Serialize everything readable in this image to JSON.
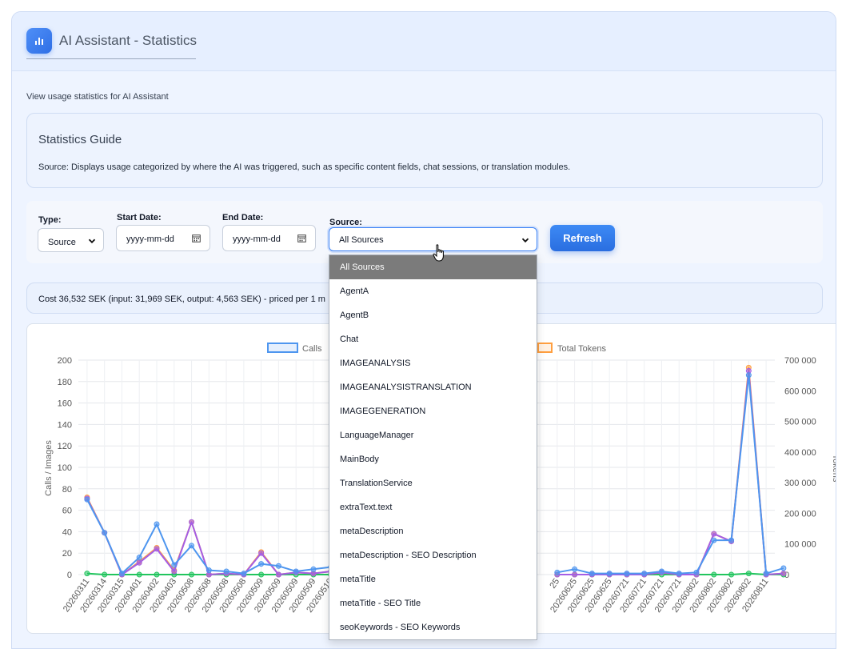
{
  "header": {
    "title": "AI Assistant - Statistics",
    "icon": "bar-chart-icon"
  },
  "subtitle": "View usage statistics for AI Assistant",
  "guide": {
    "title": "Statistics Guide",
    "text": "Source: Displays usage categorized by where the AI was triggered, such as specific content fields, chat sessions, or translation modules."
  },
  "filters": {
    "type_label": "Type:",
    "type_value": "Source",
    "start_label": "Start Date:",
    "start_placeholder": "yyyy-mm-dd",
    "end_label": "End Date:",
    "end_placeholder": "yyyy-mm-dd",
    "source_label": "Source:",
    "source_value": "All Sources",
    "refresh_label": "Refresh"
  },
  "cost_text": "Cost 36,532 SEK (input: 31,969 SEK, output: 4,563 SEK) - priced per 1 m",
  "dropdown": {
    "options": [
      "All Sources",
      "AgentA",
      "AgentB",
      "Chat",
      "IMAGEANALYSIS",
      "IMAGEANALYSISTRANSLATION",
      "IMAGEGENERATION",
      "LanguageManager",
      "MainBody",
      "TranslationService",
      "extraText.text",
      "metaDescription",
      "metaDescription - SEO Description",
      "metaTitle",
      "metaTitle - SEO Title",
      "seoKeywords - SEO Keywords"
    ],
    "selected": "All Sources"
  },
  "chart_data": {
    "type": "line",
    "legend": [
      "Calls",
      "Total Tokens"
    ],
    "ylabel_left": "Calls / Images",
    "ylabel_right": "Tokens",
    "y_left_ticks": [
      "0",
      "20",
      "40",
      "60",
      "80",
      "100",
      "120",
      "140",
      "160",
      "180",
      "200"
    ],
    "y_right_ticks": [
      "0",
      "100 000",
      "200 000",
      "300 000",
      "400 000",
      "500 000",
      "600 000",
      "700 000"
    ],
    "ylim_left": [
      0,
      200
    ],
    "ylim_right": [
      0,
      700000
    ],
    "x": [
      "20260311",
      "20260314",
      "20260315",
      "20260401",
      "20260402",
      "20260403",
      "20260508",
      "20260508",
      "20260508",
      "20260508",
      "20260509",
      "20260509",
      "20260509",
      "20260509",
      "20260510",
      "",
      "",
      "",
      "",
      "",
      "",
      "",
      "",
      "",
      "",
      "",
      "",
      "25",
      "20260625",
      "20260625",
      "20260625",
      "20260721",
      "20260721",
      "20260721",
      "20260721",
      "20260802",
      "20260802",
      "20260802",
      "20260802",
      "20260811"
    ],
    "series": [
      {
        "name": "Calls",
        "color": "#4e96ef",
        "values": [
          70,
          39,
          1,
          16,
          47,
          9,
          27,
          4,
          3,
          1,
          10,
          8,
          3,
          5,
          7,
          null,
          null,
          null,
          null,
          null,
          null,
          null,
          null,
          null,
          null,
          null,
          null,
          2,
          5,
          1,
          1,
          1,
          1,
          3,
          1,
          2,
          32,
          32,
          186,
          1,
          6
        ]
      },
      {
        "name": "",
        "color": "#a45ee5",
        "values": [
          71,
          39,
          0,
          11,
          24,
          3,
          49,
          0,
          1,
          0,
          20,
          0,
          2,
          1,
          3,
          null,
          null,
          null,
          null,
          null,
          null,
          null,
          null,
          null,
          null,
          null,
          null,
          0,
          0,
          0,
          0,
          0,
          0,
          2,
          0,
          0,
          38,
          31,
          190,
          0,
          1
        ]
      },
      {
        "name": "",
        "color": "#ff9f40",
        "values": [
          72,
          39,
          0,
          12,
          25,
          4,
          49,
          0,
          1,
          0,
          21,
          0,
          2,
          1,
          3,
          null,
          null,
          null,
          null,
          null,
          null,
          null,
          null,
          null,
          null,
          null,
          null,
          0,
          0,
          0,
          0,
          0,
          0,
          2,
          0,
          0,
          38,
          31,
          193,
          0,
          1
        ]
      },
      {
        "name": "",
        "color": "#22c55e",
        "values": [
          1,
          0,
          0,
          0,
          0,
          0,
          0,
          0,
          0,
          0,
          0,
          0,
          0,
          0,
          0,
          null,
          null,
          null,
          null,
          null,
          null,
          null,
          null,
          null,
          null,
          null,
          null,
          0,
          0,
          0,
          0,
          0,
          0,
          0,
          0,
          0,
          0,
          0,
          1,
          0,
          0
        ]
      }
    ]
  }
}
